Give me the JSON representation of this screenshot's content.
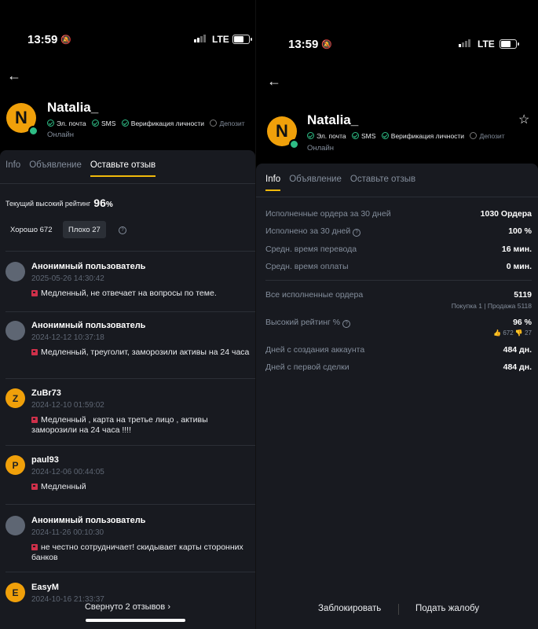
{
  "status_left": {
    "time": "13:59",
    "network": "LTE"
  },
  "status_right": {
    "time": "13:59",
    "network": "LTE"
  },
  "profile": {
    "initial": "N",
    "name": "Natalia_",
    "verifications": [
      "Эл. почта",
      "SMS",
      "Верификация личности"
    ],
    "deposit": "Депозит",
    "status": "Онлайн"
  },
  "left_tabs": [
    "Info",
    "Объявление",
    "Оставьте отзыв"
  ],
  "right_tabs": [
    "Info",
    "Объявление",
    "Оставьте отзыв"
  ],
  "rating": {
    "label": "Текущий высокий рейтинг",
    "value": "96",
    "unit": "%",
    "good": "Хорошо 672",
    "bad": "Плохо 27",
    "help": "?"
  },
  "reviews": [
    {
      "initial": "",
      "name": "Анонимный пользователь",
      "date": "2025-05-26 14:30:42",
      "text": "Медленный, не отвечает на вопросы по теме."
    },
    {
      "initial": "",
      "name": "Анонимный пользователь",
      "date": "2024-12-12 10:37:18",
      "text": "Медленный, треуголит, заморозили активы на 24 часа"
    },
    {
      "initial": "Z",
      "name": "ZuBr73",
      "date": "2024-12-10 01:59:02",
      "text": "Медленный , карта на третье лицо , активы заморозили на 24 часа !!!!"
    },
    {
      "initial": "P",
      "name": "paul93",
      "date": "2024-12-06 00:44:05",
      "text": "Медленный"
    },
    {
      "initial": "",
      "name": "Анонимный пользователь",
      "date": "2024-11-26 00:10:30",
      "text": "не честно сотрудничает! скидывает карты сторонних банков"
    },
    {
      "initial": "E",
      "name": "EasyM",
      "date": "2024-10-16 21:33:37",
      "text": ""
    }
  ],
  "collapse_label": "Свернуто 2 отзывов",
  "info": {
    "orders_30d": {
      "label": "Исполненные ордера за 30 дней",
      "value": "1030 Ордера"
    },
    "executed_30d": {
      "label": "Исполнено за 30 дней",
      "value": "100 %"
    },
    "avg_transfer": {
      "label": "Средн. время перевода",
      "value": "16 мин."
    },
    "avg_payment": {
      "label": "Средн. время оплаты",
      "value": "0 мин."
    },
    "all_orders": {
      "label": "Все исполненные ордера",
      "value": "5119",
      "note": "Покупка 1 | Продажа 5118"
    },
    "high_rating": {
      "label": "Высокий рейтинг %",
      "value": "96 %",
      "note": "👍 672 👎 27"
    },
    "days_account": {
      "label": "Дней с создания аккаунта",
      "value": "484 дн."
    },
    "days_first_deal": {
      "label": "Дней с первой сделки",
      "value": "484 дн."
    }
  },
  "actions": {
    "block": "Заблокировать",
    "report": "Подать жалобу"
  }
}
